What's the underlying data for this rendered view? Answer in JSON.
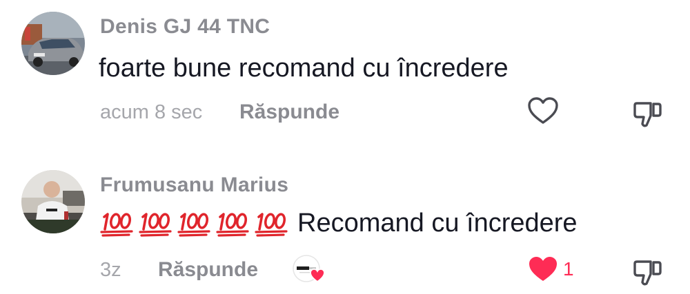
{
  "comments": [
    {
      "username": "Denis GJ 44 TNC",
      "text": "foarte bune recomand cu încredere",
      "time": "acum 8 sec",
      "reply_label": "Răspunde",
      "liked": false,
      "like_count": ""
    },
    {
      "username": "Frumusanu Marius",
      "emoji_icons": [
        "hundred-points-icon",
        "hundred-points-icon",
        "hundred-points-icon",
        "hundred-points-icon",
        "hundred-points-icon"
      ],
      "text": "Recomand cu încredere",
      "time": "3z",
      "reply_label": "Răspunde",
      "liked": true,
      "like_count": "1",
      "creator_reaction": {
        "avatar_text": "maxif",
        "icon": "heart-icon"
      }
    }
  ],
  "colors": {
    "liked_red": "#fe2c55",
    "username_gray": "#8a8b91",
    "meta_gray": "#a5a6ab",
    "text_dark": "#161823"
  }
}
